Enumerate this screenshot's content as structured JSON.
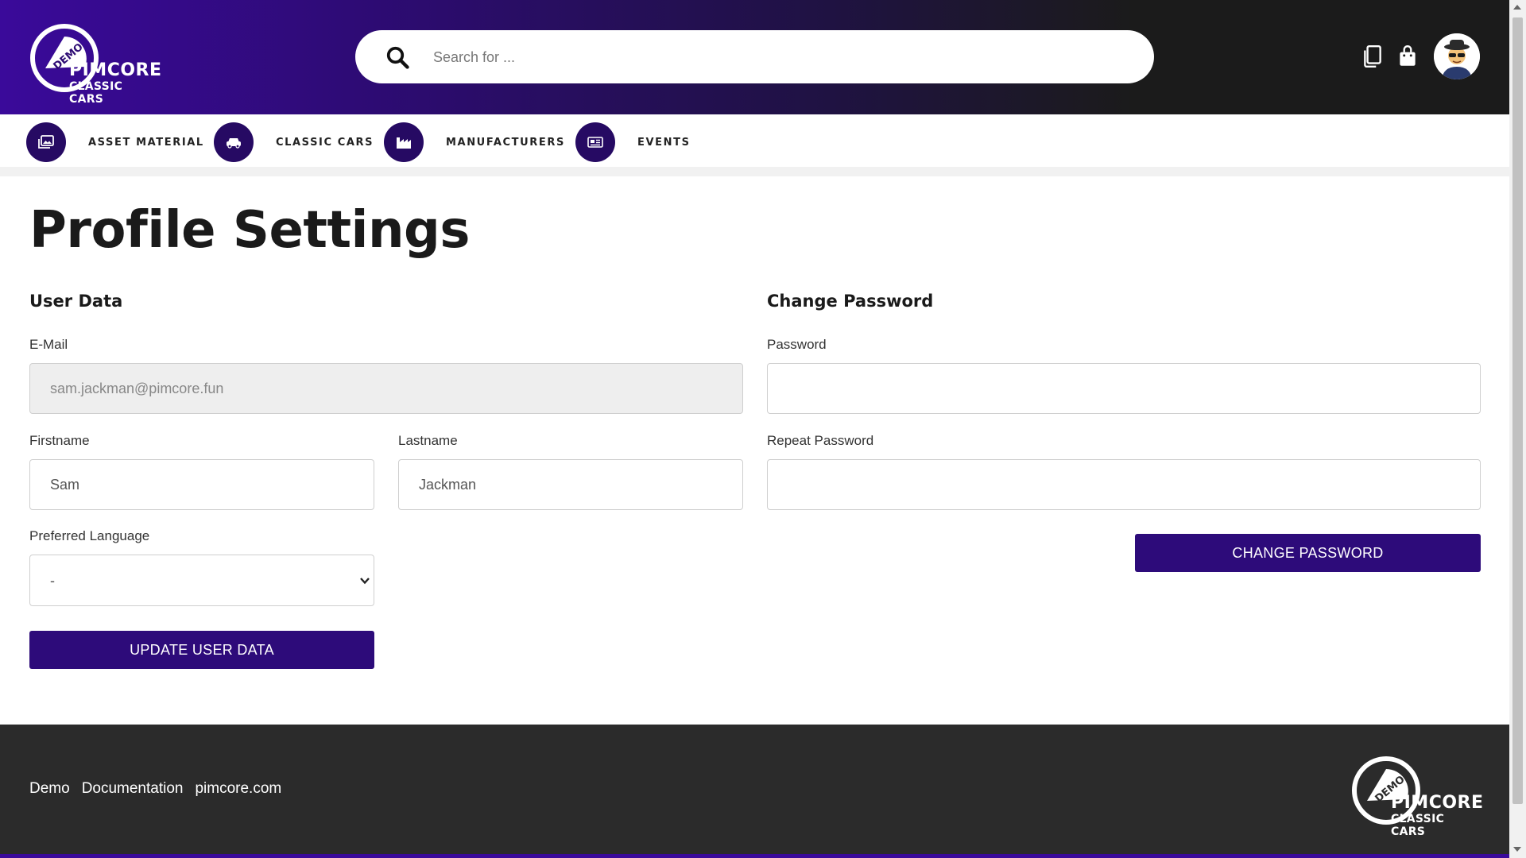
{
  "brand": {
    "name": "PIMCORE",
    "subtitle": "CLASSIC CARS",
    "badge": "DEMO",
    "color_primary": "#2d0b7a",
    "color_header_dark": "#1b1b1b"
  },
  "search": {
    "placeholder": "Search for ...",
    "value": ""
  },
  "header_icons": [
    "compare-icon",
    "shopping-bag-icon",
    "user-avatar"
  ],
  "nav": {
    "items": [
      {
        "label": "ASSET MATERIAL",
        "icon": "images-icon"
      },
      {
        "label": "CLASSIC CARS",
        "icon": "car-icon"
      },
      {
        "label": "MANUFACTURERS",
        "icon": "factory-icon"
      },
      {
        "label": "EVENTS",
        "icon": "newspaper-icon"
      }
    ]
  },
  "page": {
    "title": "Profile Settings"
  },
  "user_data": {
    "title": "User Data",
    "email_label": "E-Mail",
    "email_value": "sam.jackman@pimcore.fun",
    "firstname_label": "Firstname",
    "firstname_value": "Sam",
    "lastname_label": "Lastname",
    "lastname_value": "Jackman",
    "language_label": "Preferred Language",
    "language_value": "-",
    "submit_label": "UPDATE USER DATA"
  },
  "change_password": {
    "title": "Change Password",
    "password_label": "Password",
    "password_value": "",
    "repeat_label": "Repeat Password",
    "repeat_value": "",
    "submit_label": "CHANGE PASSWORD"
  },
  "footer": {
    "links": [
      "Demo",
      "Documentation",
      "pimcore.com"
    ]
  }
}
